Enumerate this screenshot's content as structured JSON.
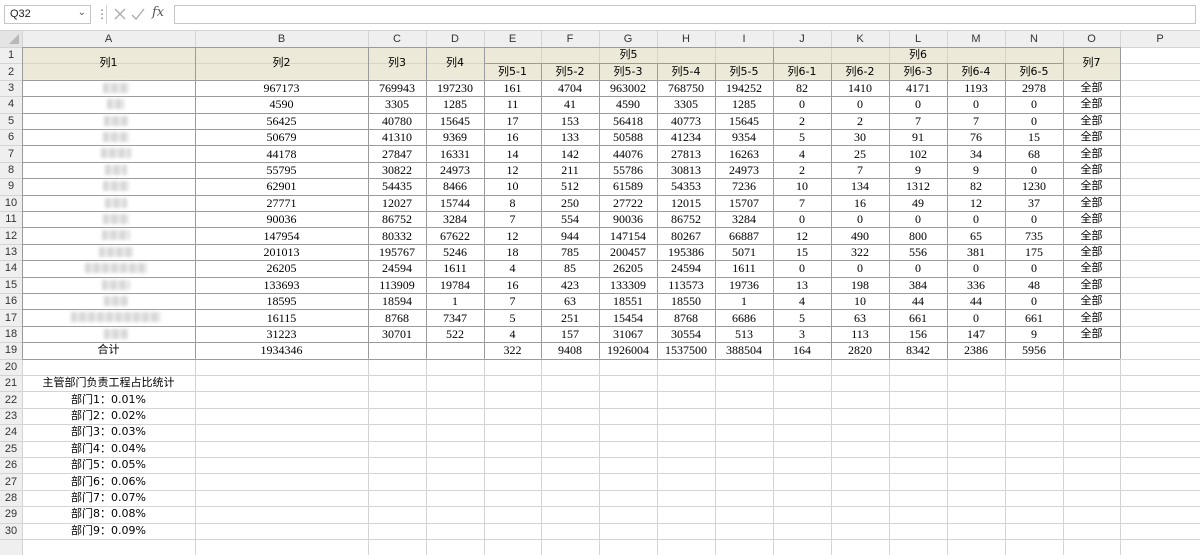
{
  "name_box": {
    "value": "Q32"
  },
  "formula_bar": {
    "fx_label": "fx",
    "value": ""
  },
  "columns": [
    "A",
    "B",
    "C",
    "D",
    "E",
    "F",
    "G",
    "H",
    "I",
    "J",
    "K",
    "L",
    "M",
    "N",
    "O",
    "P"
  ],
  "rows": [
    "1",
    "2",
    "3",
    "4",
    "5",
    "6",
    "7",
    "8",
    "9",
    "10",
    "11",
    "12",
    "13",
    "14",
    "15",
    "16",
    "17",
    "18",
    "19",
    "20",
    "21",
    "22",
    "23",
    "24",
    "25",
    "26",
    "27",
    "28",
    "29",
    "30"
  ],
  "header": {
    "col1": "列1",
    "col2": "列2",
    "col3": "列3",
    "col4": "列4",
    "col5": "列5",
    "col6": "列6",
    "col7": "列7",
    "sub5": [
      "列5-1",
      "列5-2",
      "列5-3",
      "列5-4",
      "列5-5"
    ],
    "sub6": [
      "列6-1",
      "列6-2",
      "列6-3",
      "列6-4",
      "列6-5"
    ]
  },
  "data_rows": [
    [
      "967173",
      "769943",
      "197230",
      "161",
      "4704",
      "963002",
      "768750",
      "194252",
      "82",
      "1410",
      "4171",
      "1193",
      "2978",
      "全部"
    ],
    [
      "4590",
      "3305",
      "1285",
      "11",
      "41",
      "4590",
      "3305",
      "1285",
      "0",
      "0",
      "0",
      "0",
      "0",
      "全部"
    ],
    [
      "56425",
      "40780",
      "15645",
      "17",
      "153",
      "56418",
      "40773",
      "15645",
      "2",
      "2",
      "7",
      "7",
      "0",
      "全部"
    ],
    [
      "50679",
      "41310",
      "9369",
      "16",
      "133",
      "50588",
      "41234",
      "9354",
      "5",
      "30",
      "91",
      "76",
      "15",
      "全部"
    ],
    [
      "44178",
      "27847",
      "16331",
      "14",
      "142",
      "44076",
      "27813",
      "16263",
      "4",
      "25",
      "102",
      "34",
      "68",
      "全部"
    ],
    [
      "55795",
      "30822",
      "24973",
      "12",
      "211",
      "55786",
      "30813",
      "24973",
      "2",
      "7",
      "9",
      "9",
      "0",
      "全部"
    ],
    [
      "62901",
      "54435",
      "8466",
      "10",
      "512",
      "61589",
      "54353",
      "7236",
      "10",
      "134",
      "1312",
      "82",
      "1230",
      "全部"
    ],
    [
      "27771",
      "12027",
      "15744",
      "8",
      "250",
      "27722",
      "12015",
      "15707",
      "7",
      "16",
      "49",
      "12",
      "37",
      "全部"
    ],
    [
      "90036",
      "86752",
      "3284",
      "7",
      "554",
      "90036",
      "86752",
      "3284",
      "0",
      "0",
      "0",
      "0",
      "0",
      "全部"
    ],
    [
      "147954",
      "80332",
      "67622",
      "12",
      "944",
      "147154",
      "80267",
      "66887",
      "12",
      "490",
      "800",
      "65",
      "735",
      "全部"
    ],
    [
      "201013",
      "195767",
      "5246",
      "18",
      "785",
      "200457",
      "195386",
      "5071",
      "15",
      "322",
      "556",
      "381",
      "175",
      "全部"
    ],
    [
      "26205",
      "24594",
      "1611",
      "4",
      "85",
      "26205",
      "24594",
      "1611",
      "0",
      "0",
      "0",
      "0",
      "0",
      "全部"
    ],
    [
      "133693",
      "113909",
      "19784",
      "16",
      "423",
      "133309",
      "113573",
      "19736",
      "13",
      "198",
      "384",
      "336",
      "48",
      "全部"
    ],
    [
      "18595",
      "18594",
      "1",
      "7",
      "63",
      "18551",
      "18550",
      "1",
      "4",
      "10",
      "44",
      "44",
      "0",
      "全部"
    ],
    [
      "16115",
      "8768",
      "7347",
      "5",
      "251",
      "15454",
      "8768",
      "6686",
      "5",
      "63",
      "661",
      "0",
      "661",
      "全部"
    ],
    [
      "31223",
      "30701",
      "522",
      "4",
      "157",
      "31067",
      "30554",
      "513",
      "3",
      "113",
      "156",
      "147",
      "9",
      "全部"
    ]
  ],
  "totals": {
    "label": "合计",
    "values": [
      "1934346",
      "",
      "",
      "322",
      "9408",
      "1926004",
      "1537500",
      "388504",
      "164",
      "2820",
      "8342",
      "2386",
      "5956",
      ""
    ]
  },
  "notes": {
    "title": "主管部门负责工程占比统计",
    "items": [
      "部门1：0.01%",
      "部门2：0.02%",
      "部门3：0.03%",
      "部门4：0.04%",
      "部门5：0.05%",
      "部门6：0.06%",
      "部门7：0.07%",
      "部门8：0.08%",
      "部门9：0.09%"
    ]
  },
  "colors": {
    "header_fill": "#ece9d8",
    "grid_line": "#d4d4d4",
    "header_border": "#9b9b9b",
    "chrome_bg": "#efefef"
  }
}
